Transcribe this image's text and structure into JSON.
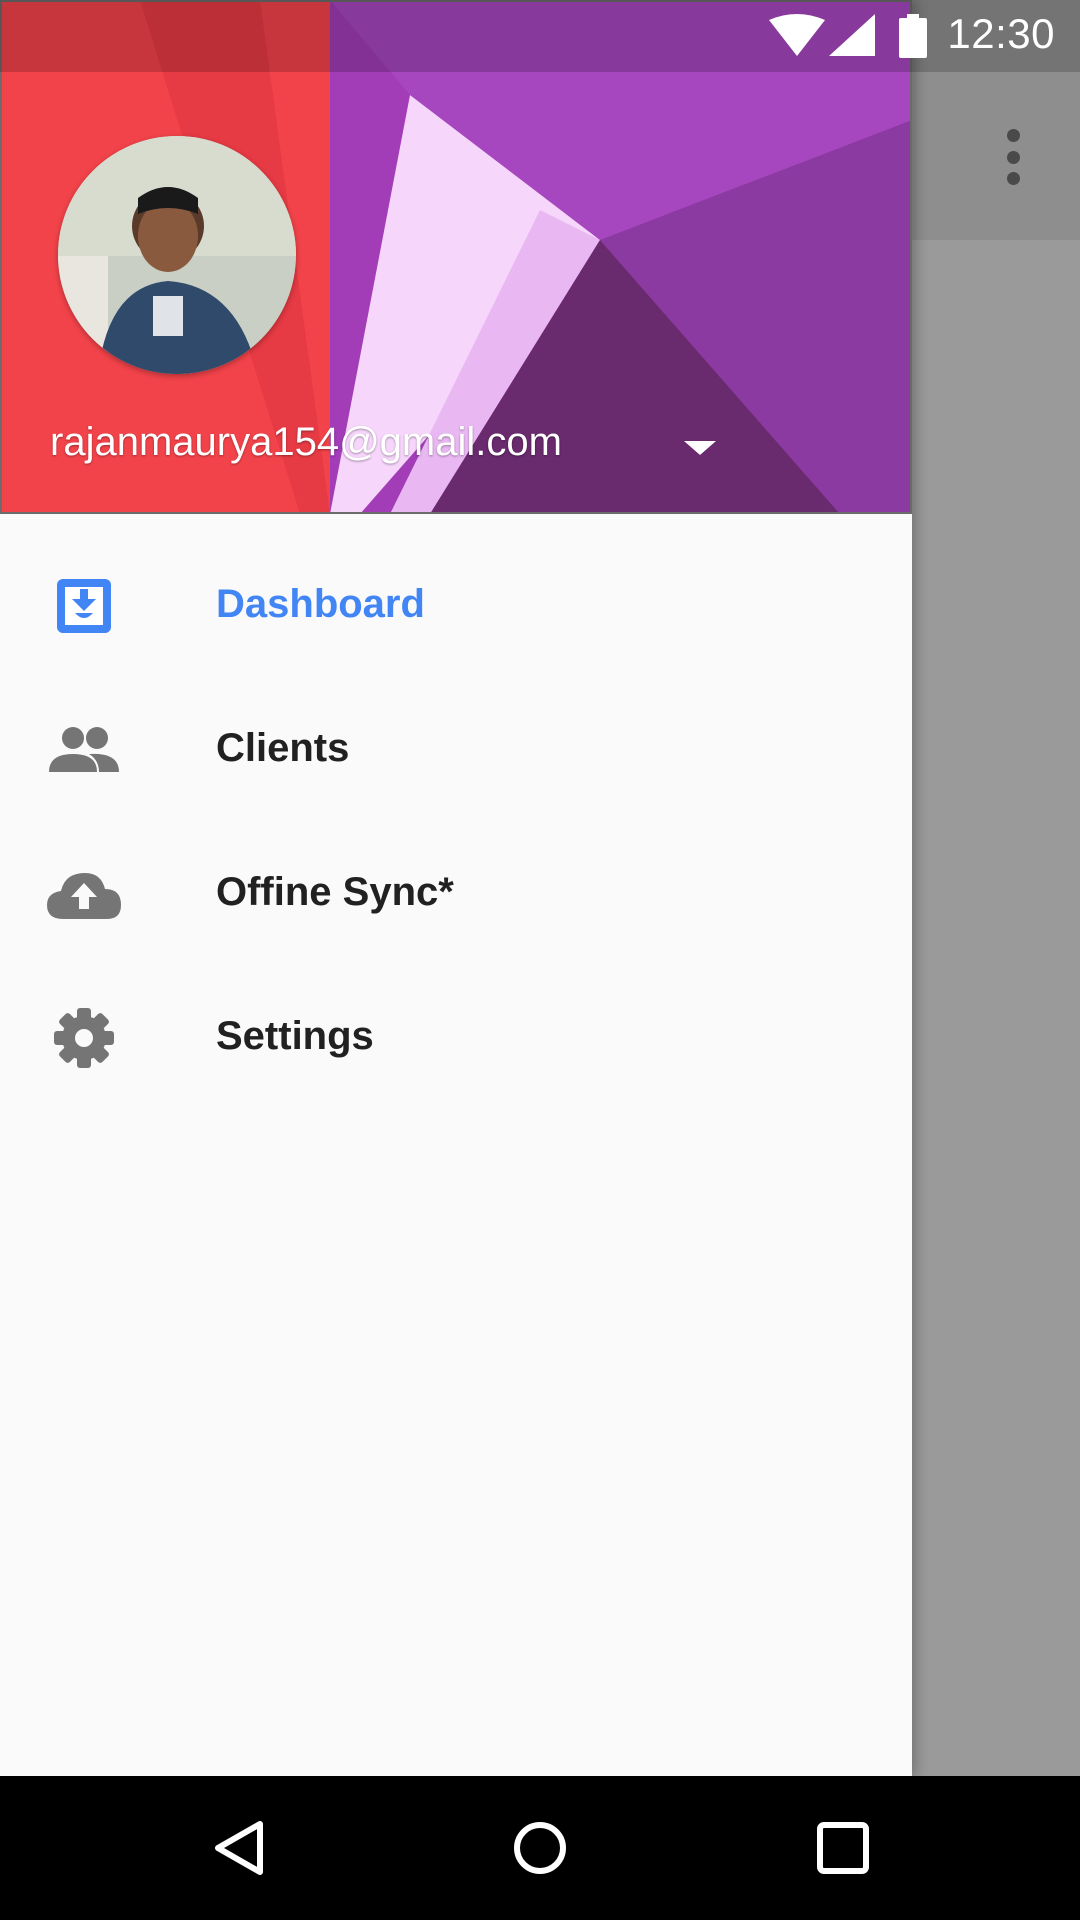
{
  "status_bar": {
    "time": "12:30"
  },
  "drawer": {
    "account_email": "rajanmaurya154@gmail.com",
    "menu": [
      {
        "label": "Dashboard",
        "icon": "inbox-download-icon",
        "active": true
      },
      {
        "label": "Clients",
        "icon": "people-icon",
        "active": false
      },
      {
        "label": "Offine Sync*",
        "icon": "cloud-upload-icon",
        "active": false
      },
      {
        "label": "Settings",
        "icon": "gear-icon",
        "active": false
      }
    ]
  },
  "colors": {
    "accent": "#4285f4",
    "header_red": "#f2434a",
    "header_purple": "#9c3ab3",
    "icon_gray": "#757575"
  }
}
